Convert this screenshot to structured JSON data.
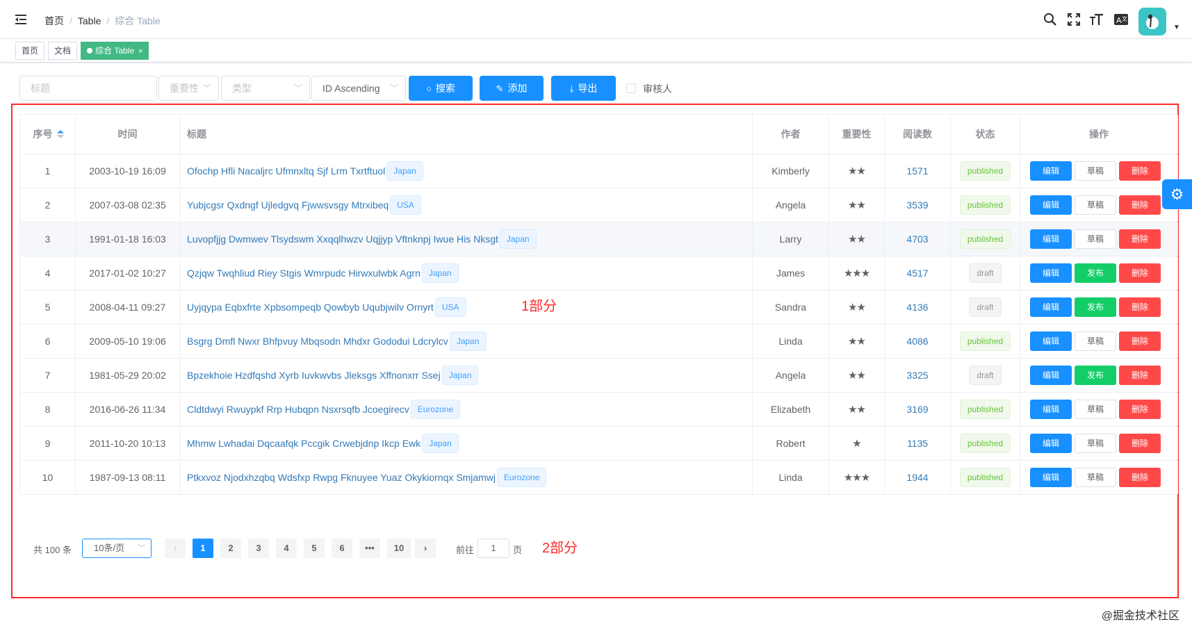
{
  "navbar": {
    "breadcrumb": [
      "首页",
      "Table",
      "综合 Table"
    ]
  },
  "tags": [
    {
      "label": "首页",
      "active": false
    },
    {
      "label": "文档",
      "active": false
    },
    {
      "label": "综合 Table",
      "active": true,
      "close": "×"
    }
  ],
  "filter": {
    "title_placeholder": "标题",
    "importance_placeholder": "重要性",
    "type_placeholder": "类型",
    "sort_value": "ID Ascending",
    "search_label": "搜索",
    "add_label": "添加",
    "export_label": "导出",
    "reviewer_label": "审核人"
  },
  "table": {
    "headers": [
      "序号",
      "时间",
      "标题",
      "作者",
      "重要性",
      "阅读数",
      "状态",
      "操作"
    ],
    "rows": [
      {
        "id": "1",
        "time": "2003-10-19 16:09",
        "title": "Ofochp Hfli Nacaljrc Ufmnxltq Sjf Lrm Txrtftuol",
        "tag": "Japan",
        "author": "Kimberly",
        "stars": 2,
        "reads": "1571",
        "status": "published",
        "action2": "草稿"
      },
      {
        "id": "2",
        "time": "2007-03-08 02:35",
        "title": "Yubjcgsr Qxdngf Ujledgvq Fjwwsvsgy Mtrxibeq",
        "tag": "USA",
        "author": "Angela",
        "stars": 2,
        "reads": "3539",
        "status": "published",
        "action2": "草稿"
      },
      {
        "id": "3",
        "time": "1991-01-18 16:03",
        "title": "Luvopfjjg Dwmwev Tlsydswm Xxqqlhwzv Uqjjyp Vftnknpj Iwue His Nksgt",
        "tag": "Japan",
        "author": "Larry",
        "stars": 2,
        "reads": "4703",
        "status": "published",
        "action2": "草稿"
      },
      {
        "id": "4",
        "time": "2017-01-02 10:27",
        "title": "Qzjqw Twqhliud Riey Stgis Wmrpudc Hirwxulwbk Agrn",
        "tag": "Japan",
        "author": "James",
        "stars": 3,
        "reads": "4517",
        "status": "draft",
        "action2": "发布"
      },
      {
        "id": "5",
        "time": "2008-04-11 09:27",
        "title": "Uyjqypa Eqbxfrte Xpbsompeqb Qowbyb Uqubjwilv Ornyrt",
        "tag": "USA",
        "author": "Sandra",
        "stars": 2,
        "reads": "4136",
        "status": "draft",
        "action2": "发布"
      },
      {
        "id": "6",
        "time": "2009-05-10 19:06",
        "title": "Bsgrg Dmfl Nwxr Bhfpvuy Mbqsodn Mhdxr Gododui Ldcrylcv",
        "tag": "Japan",
        "author": "Linda",
        "stars": 2,
        "reads": "4086",
        "status": "published",
        "action2": "草稿"
      },
      {
        "id": "7",
        "time": "1981-05-29 20:02",
        "title": "Bpzekhoie Hzdfqshd Xyrb Iuvkwvbs Jleksgs Xffnonxrr Ssej",
        "tag": "Japan",
        "author": "Angela",
        "stars": 2,
        "reads": "3325",
        "status": "draft",
        "action2": "发布"
      },
      {
        "id": "8",
        "time": "2016-06-26 11:34",
        "title": "Cldtdwyi Rwuypkf Rrp Hubqpn Nsxrsqfb Jcoegirecv",
        "tag": "Eurozone",
        "author": "Elizabeth",
        "stars": 2,
        "reads": "3169",
        "status": "published",
        "action2": "草稿"
      },
      {
        "id": "9",
        "time": "2011-10-20 10:13",
        "title": "Mhmw Lwhadai Dqcaafqk Pccgik Crwebjdnp Ikcp Ewk",
        "tag": "Japan",
        "author": "Robert",
        "stars": 1,
        "reads": "1135",
        "status": "published",
        "action2": "草稿"
      },
      {
        "id": "10",
        "time": "1987-09-13 08:11",
        "title": "Ptkxvoz Njodxhzqbq Wdsfxp Rwpg Fknuyee Yuaz Okykiornqx Smjamwj",
        "tag": "Eurozone",
        "author": "Linda",
        "stars": 3,
        "reads": "1944",
        "status": "published",
        "action2": "草稿"
      }
    ],
    "edit_label": "编辑",
    "delete_label": "删除"
  },
  "pagination": {
    "total": "共 100 条",
    "page_size": "10条/页",
    "pages": [
      "1",
      "2",
      "3",
      "4",
      "5",
      "6",
      "•••",
      "10"
    ],
    "current": "1",
    "prev": "‹",
    "next": "›",
    "goto_prefix": "前往",
    "goto_value": "1",
    "goto_suffix": "页"
  },
  "annotations": {
    "part1": "1部分",
    "part2": "2部分"
  },
  "watermark": "@掘金技术社区",
  "colors": {
    "primary": "#1890ff",
    "success": "#13ce66",
    "danger": "#ff4949",
    "annotation": "#ff2a2a",
    "tag_active": "#42b983"
  }
}
